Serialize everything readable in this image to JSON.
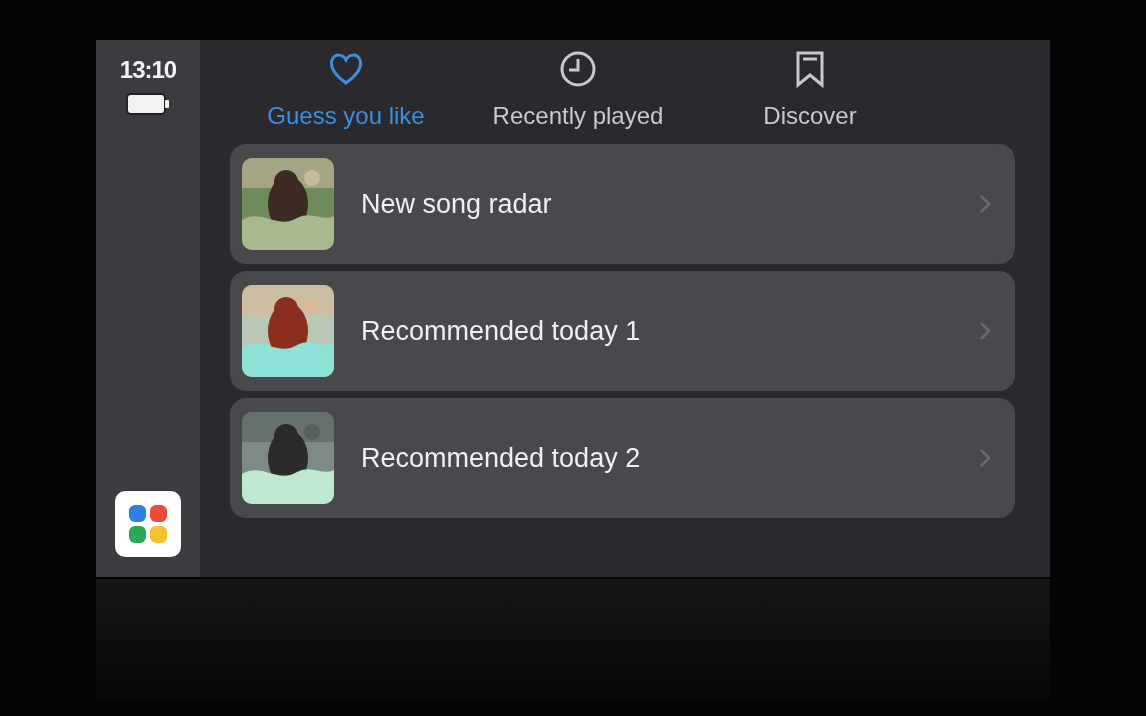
{
  "status": {
    "time": "13:10"
  },
  "tabs": [
    {
      "label": "Guess you like",
      "kind": "heart",
      "selected": true
    },
    {
      "label": "Recently played",
      "kind": "clock",
      "selected": false
    },
    {
      "label": "Discover",
      "kind": "bookmark",
      "selected": false
    }
  ],
  "playlists": [
    {
      "title": "New song radar"
    },
    {
      "title": "Recommended today 1"
    },
    {
      "title": "Recommended today 2"
    }
  ]
}
